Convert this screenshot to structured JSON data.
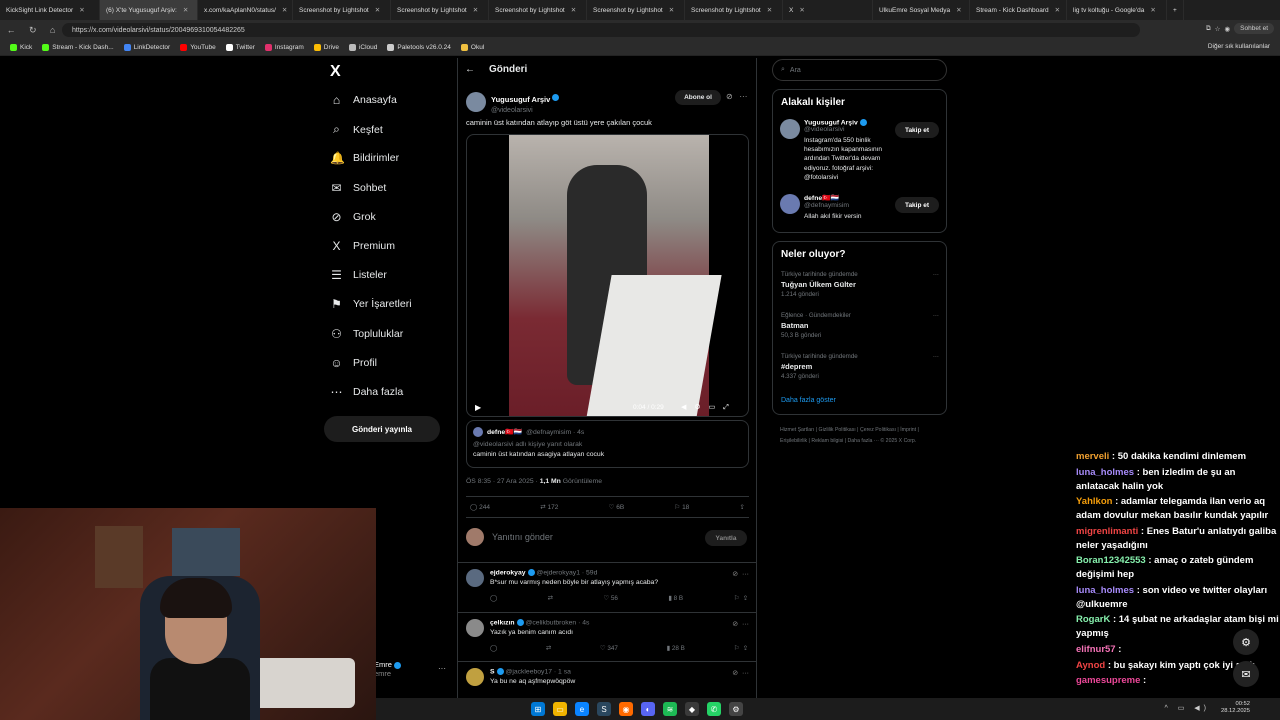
{
  "browser": {
    "tabs": [
      {
        "label": "KickSight Link Detector",
        "active": false
      },
      {
        "label": "(6) X'te Yugusuguf Arşiv:",
        "active": true
      },
      {
        "label": "x.com/kaAplanN0/status/",
        "active": false
      },
      {
        "label": "Screenshot by Lightshot",
        "active": false
      },
      {
        "label": "Screenshot by Lightshot",
        "active": false
      },
      {
        "label": "Screenshot by Lightshot",
        "active": false
      },
      {
        "label": "Screenshot by Lightshot",
        "active": false
      },
      {
        "label": "Screenshot by Lightshot",
        "active": false
      },
      {
        "label": "X",
        "active": false
      },
      {
        "label": "UlkuEmre Sosyal Medya",
        "active": false
      },
      {
        "label": "Stream - Kick Dashboard",
        "active": false
      },
      {
        "label": "lig tv koltuğu - Google'da",
        "active": false
      }
    ],
    "url": "https://x.com/videolarsivi/status/2004969310054482265",
    "chat_pill": "Sohbet et",
    "bookmarks": [
      {
        "label": "Kick",
        "color": "#53fc18"
      },
      {
        "label": "Stream - Kick Dash...",
        "color": "#53fc18"
      },
      {
        "label": "LinkDetector",
        "color": "#4285f4"
      },
      {
        "label": "YouTube",
        "color": "#ff0000"
      },
      {
        "label": "Twitter",
        "color": "#ffffff"
      },
      {
        "label": "Instagram",
        "color": "#e1306c"
      },
      {
        "label": "Drive",
        "color": "#fbbc04"
      },
      {
        "label": "iCloud",
        "color": "#bbbbbb"
      },
      {
        "label": "Paletools v26.0.24",
        "color": "#cccccc"
      },
      {
        "label": "Okul",
        "color": "#f0c040"
      }
    ],
    "bookmarks_other": "Diğer sık kullanılanlar"
  },
  "sidebar": {
    "logo": "X",
    "items": [
      {
        "label": "Anasayfa",
        "icon": "⌂"
      },
      {
        "label": "Keşfet",
        "icon": "⌕"
      },
      {
        "label": "Bildirimler",
        "icon": "🔔"
      },
      {
        "label": "Sohbet",
        "icon": "✉"
      },
      {
        "label": "Grok",
        "icon": "⊘"
      },
      {
        "label": "Premium",
        "icon": "X"
      },
      {
        "label": "Listeler",
        "icon": "☰"
      },
      {
        "label": "Yer İşaretleri",
        "icon": "⚑"
      },
      {
        "label": "Topluluklar",
        "icon": "⚇"
      },
      {
        "label": "Profil",
        "icon": "☺"
      },
      {
        "label": "Daha fazla",
        "icon": "⋯"
      }
    ],
    "post_button": "Gönderi yayınla",
    "account_name": "Emre",
    "account_handle": "emre"
  },
  "post": {
    "header": "Gönderi",
    "author": "Yugusuguf Arşiv",
    "handle": "@videolarsivi",
    "subscribe": "Abone ol",
    "text": "caminin üst katından atlayıp göt üstü yere çakılan çocuk",
    "video_time": "0:04 / 0:29",
    "quote": {
      "name": "defne🇹🇷🇳🇱",
      "handle": "@defnaymisim · 4s",
      "replying": "@videolarsivi adlı kişiye yanıt olarak",
      "text": "caminin üst katından asagiya atlayan cocuk"
    },
    "meta_time": "ÖS 8:35 · 27 Ara 2025 · ",
    "meta_views": "1,1 Mn",
    "meta_views_label": " Görüntüleme",
    "stats": {
      "replies": "244",
      "retweets": "172",
      "likes": "6B",
      "bookmarks": "18"
    },
    "reply_placeholder": "Yanıtını gönder",
    "reply_button": "Yanıtla"
  },
  "replies": [
    {
      "name": "ejderokyay",
      "handle": "@ejderokyay1 · 59d",
      "text": "B*sur mu varmış neden böyle bir atlayış yapmış acaba?",
      "likes": "56",
      "views": "8 B"
    },
    {
      "name": "çelkızın",
      "handle": "@celikbutbroken · 4s",
      "text": "Yazık ya benim canım acıdı",
      "likes": "347",
      "views": "28 B"
    },
    {
      "name": "S",
      "handle": "@jackleeboy17 · 1 sa",
      "text": "Ya bu ne aq aşfmepwöqpöw",
      "likes": "",
      "views": ""
    }
  ],
  "right": {
    "search_placeholder": "Ara",
    "related_title": "Alakalı kişiler",
    "people": [
      {
        "name": "Yugusuguf Arşiv",
        "handle": "@videolarsivi",
        "bio": "Instagram'da 550 binlik hesabımızın kapanmasının ardından Twitter'da devam ediyoruz. fotoğraf arşivi: @fotolarsivi",
        "follow": "Takip et"
      },
      {
        "name": "defne🇹🇷🇳🇱",
        "handle": "@defnaymisim",
        "bio": "Allah akıl fikir versin",
        "follow": "Takip et"
      }
    ],
    "whats_title": "Neler oluyor?",
    "trends": [
      {
        "context": "Türkiye tarihinde gündemde",
        "title": "Tuğyan Ülkem Gülter",
        "count": "1.214 gönderi"
      },
      {
        "context": "Eğlence · Gündemdekiler",
        "title": "Batman",
        "count": "50,3 B gönderi"
      },
      {
        "context": "Türkiye tarihinde gündemde",
        "title": "#deprem",
        "count": "4.337 gönderi"
      }
    ],
    "show_more": "Daha fazla göster",
    "footer": "Hizmet Şartları | Gizlilik Politikası | Çerez Politikası | İmprint | Erişilebilirlik | Reklam bilgisi | Daha fazla ··· © 2025 X Corp."
  },
  "chat": [
    {
      "user": "merveli",
      "text": "50 dakika kendimi dinlemem",
      "color": "#f0a030"
    },
    {
      "user": "luna_holmes",
      "text": "ben izledim de şu an anlatacak halin yok",
      "color": "#a78bfa"
    },
    {
      "user": "Yahlkon",
      "text": "adamlar telegamda ilan verio aq adam dovulur mekan basılır kundak yapılır",
      "color": "#f59e0b"
    },
    {
      "user": "migrenlimanti",
      "text": "Enes Batur'u anlatıydı galiba neler yaşadığını",
      "color": "#ef4444"
    },
    {
      "user": "Boran12342553",
      "text": "amaç o zateb gündem değişimi hep",
      "color": "#86efac"
    },
    {
      "user": "luna_holmes",
      "text": "son video ve twitter olayları @ulkuemre",
      "color": "#a78bfa"
    },
    {
      "user": "RogarK",
      "text": "14 şubat ne arkadaşlar atam bişi mi yapmış",
      "color": "#86efac"
    },
    {
      "user": "elifnur57",
      "text": "",
      "color": "#f472b6"
    },
    {
      "user": "Aynod",
      "text": "bu şakayı kim yaptı çok iyi amk",
      "color": "#ef4444"
    },
    {
      "user": "gamesupreme",
      "text": "",
      "color": "#ec4899"
    }
  ],
  "taskbar": {
    "time": "00:52",
    "date": "28.12.2025"
  }
}
